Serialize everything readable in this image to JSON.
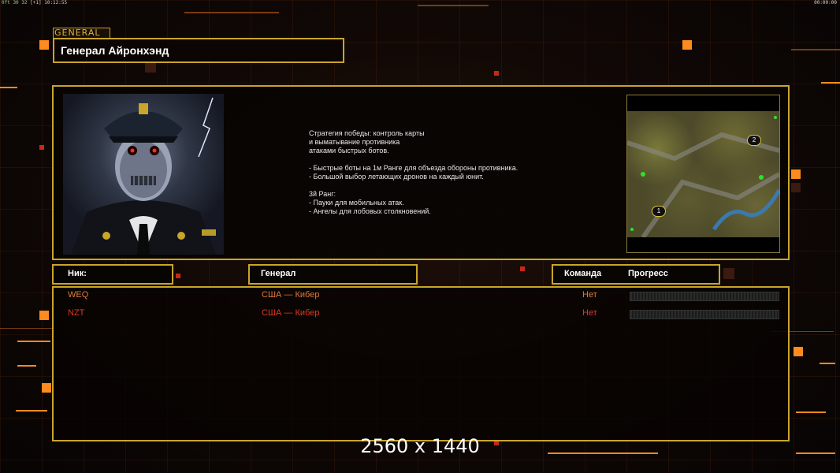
{
  "status_bar": {
    "left_a": "0ft 30 32",
    "left_b": "[+1]",
    "left_c": "10:12:55",
    "right": "00:00:00"
  },
  "general_tag": "GENERAL",
  "general_title": "Генерал Айронхэнд",
  "description": "Стратегия победы: контроль карты\nи выматывание противника\nатаками быстрых ботов.\n\n- Быстрые боты на 1м Ранге для объезда обороны противника.\n- Большой выбор летающих дронов на каждый юнит.\n\n3й Ранг:\n- Пауки для мобильных атак.\n- Ангелы для лобовых столкновений.",
  "icons": {
    "portrait": "general-portrait-image",
    "minimap": "map-preview-image"
  },
  "minimap": {
    "spawn_1": "1",
    "spawn_2": "2"
  },
  "headers": {
    "nick": "Ник:",
    "general": "Генерал",
    "team": "Команда",
    "progress": "Прогресс"
  },
  "players": [
    {
      "nick": "WEQ",
      "general": "США — Кибер",
      "team": "Нет",
      "progress": 0,
      "color": "#e07a3a"
    },
    {
      "nick": "NZT",
      "general": "США — Кибер",
      "team": "Нет",
      "progress": 0,
      "color": "#e03a22"
    }
  ],
  "resolution": "2560 x 1440",
  "colors": {
    "accent": "#c9a52a",
    "orange": "#ff8a1e"
  }
}
